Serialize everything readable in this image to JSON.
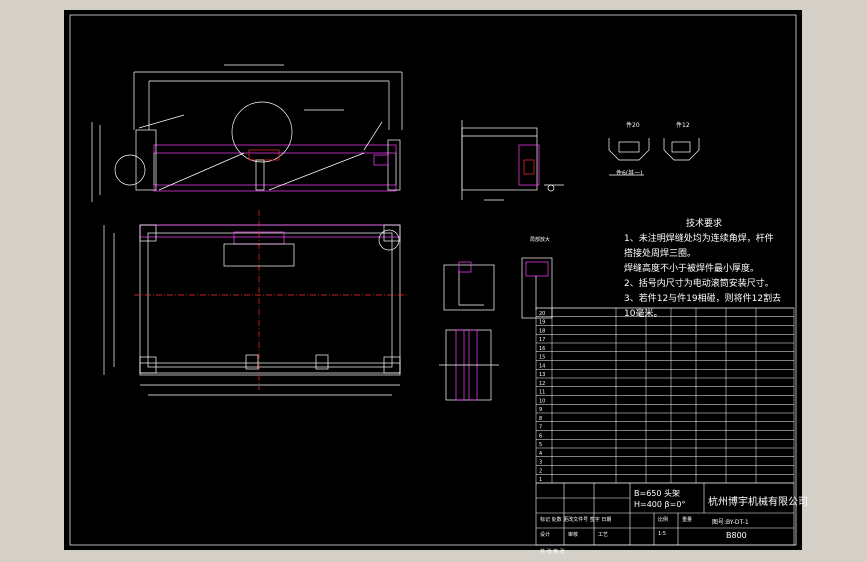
{
  "drawing": {
    "background": "#000000",
    "line_color": "#ffffff",
    "accent_colors": {
      "red": "#ff2a2a",
      "magenta": "#ff40ff",
      "cyan": "#00c8ff",
      "green": "#00d000",
      "yellow": "#ffff00"
    }
  },
  "tech_requirements": {
    "title": "技术要求",
    "items": [
      "1、未注明焊缝处均为连续角焊，杆件",
      "搭接处周焊三圈。",
      "焊缝高度不小于被焊件最小厚度。",
      "2、括号内尺寸为电动滚筒安装尺寸。",
      "3、若件12与件19相碰，则将件12割去",
      "10毫米。"
    ]
  },
  "section_labels": {
    "view_a": "件20",
    "view_b": "件12",
    "view_c": "件3",
    "view_d": "件6(其一)",
    "view_e": "局部放大"
  },
  "parts_list": {
    "row_numbers": [
      "20",
      "19",
      "18",
      "17",
      "16",
      "15",
      "14",
      "13",
      "12",
      "11",
      "10",
      "9",
      "8",
      "7",
      "6",
      "5",
      "4",
      "3",
      "2",
      "1"
    ]
  },
  "title_block": {
    "param_1": "B=650",
    "param_1_suffix": "头架",
    "param_2": "H=400",
    "param_2_suffix": "β=0°",
    "company": "杭州博宇机械有限公司",
    "drawing_no": "图号:BY-DT-1",
    "model": "B800",
    "rev_labels": "标记 处数 更改文件号 签字 日期",
    "role_design": "设计",
    "role_check": "审核",
    "role_process": "工艺",
    "scale_label": "比例",
    "weight_label": "重量",
    "scale_value": "1:5",
    "sheet_label": "共 张 第 张"
  }
}
